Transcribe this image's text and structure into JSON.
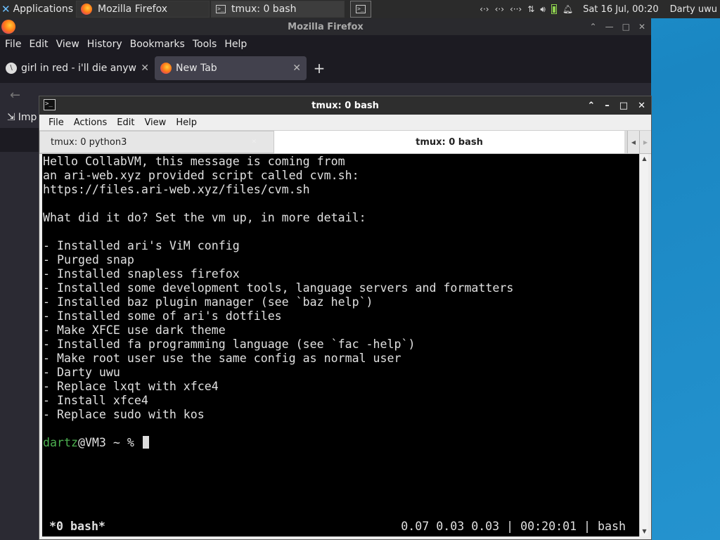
{
  "panel": {
    "applications_label": "Applications",
    "tasks": [
      {
        "label": "Mozilla Firefox"
      },
      {
        "label": "tmux: 0 bash"
      }
    ],
    "tray_icons": [
      "network-icon",
      "network-icon",
      "network-icon",
      "transfer-icon",
      "volume-icon",
      "battery-icon",
      "notification-bell-icon"
    ],
    "clock": "Sat 16 Jul, 00:20",
    "user": "Darty uwu"
  },
  "firefox": {
    "title": "Mozilla Firefox",
    "menu": [
      "File",
      "Edit",
      "View",
      "History",
      "Bookmarks",
      "Tools",
      "Help"
    ],
    "tabs": [
      {
        "label": "girl in red - i'll die anyway"
      },
      {
        "label": "New Tab"
      }
    ],
    "bookmark_partial": "Imp"
  },
  "terminal": {
    "title": "tmux: 0 bash",
    "menu": [
      "File",
      "Actions",
      "Edit",
      "View",
      "Help"
    ],
    "tabs": [
      {
        "label": "tmux: 0 python3"
      },
      {
        "label": "tmux: 0 bash"
      }
    ],
    "lines": [
      "Hello CollabVM, this message is coming from",
      "an ari-web.xyz provided script called cvm.sh:",
      "https://files.ari-web.xyz/files/cvm.sh",
      "",
      "What did it do? Set the vm up, in more detail:",
      "",
      "- Installed ari's ViM config",
      "- Purged snap",
      "- Installed snapless firefox",
      "- Installed some development tools, language servers and formatters",
      "- Installed baz plugin manager (see `baz help`)",
      "- Installed some of ari's dotfiles",
      "- Make XFCE use dark theme",
      "- Installed fa programming language (see `fac -help`)",
      "- Make root user use the same config as normal user",
      "- Darty uwu",
      "- Replace lxqt with xfce4",
      "- Install xfce4",
      "- Replace sudo with kos",
      ""
    ],
    "prompt": {
      "user": "dartz",
      "rest": "@VM3 ~ % "
    },
    "status": {
      "window": "*0 bash*",
      "right": "0.07 0.03 0.03 | 00:20:01 | bash"
    }
  }
}
